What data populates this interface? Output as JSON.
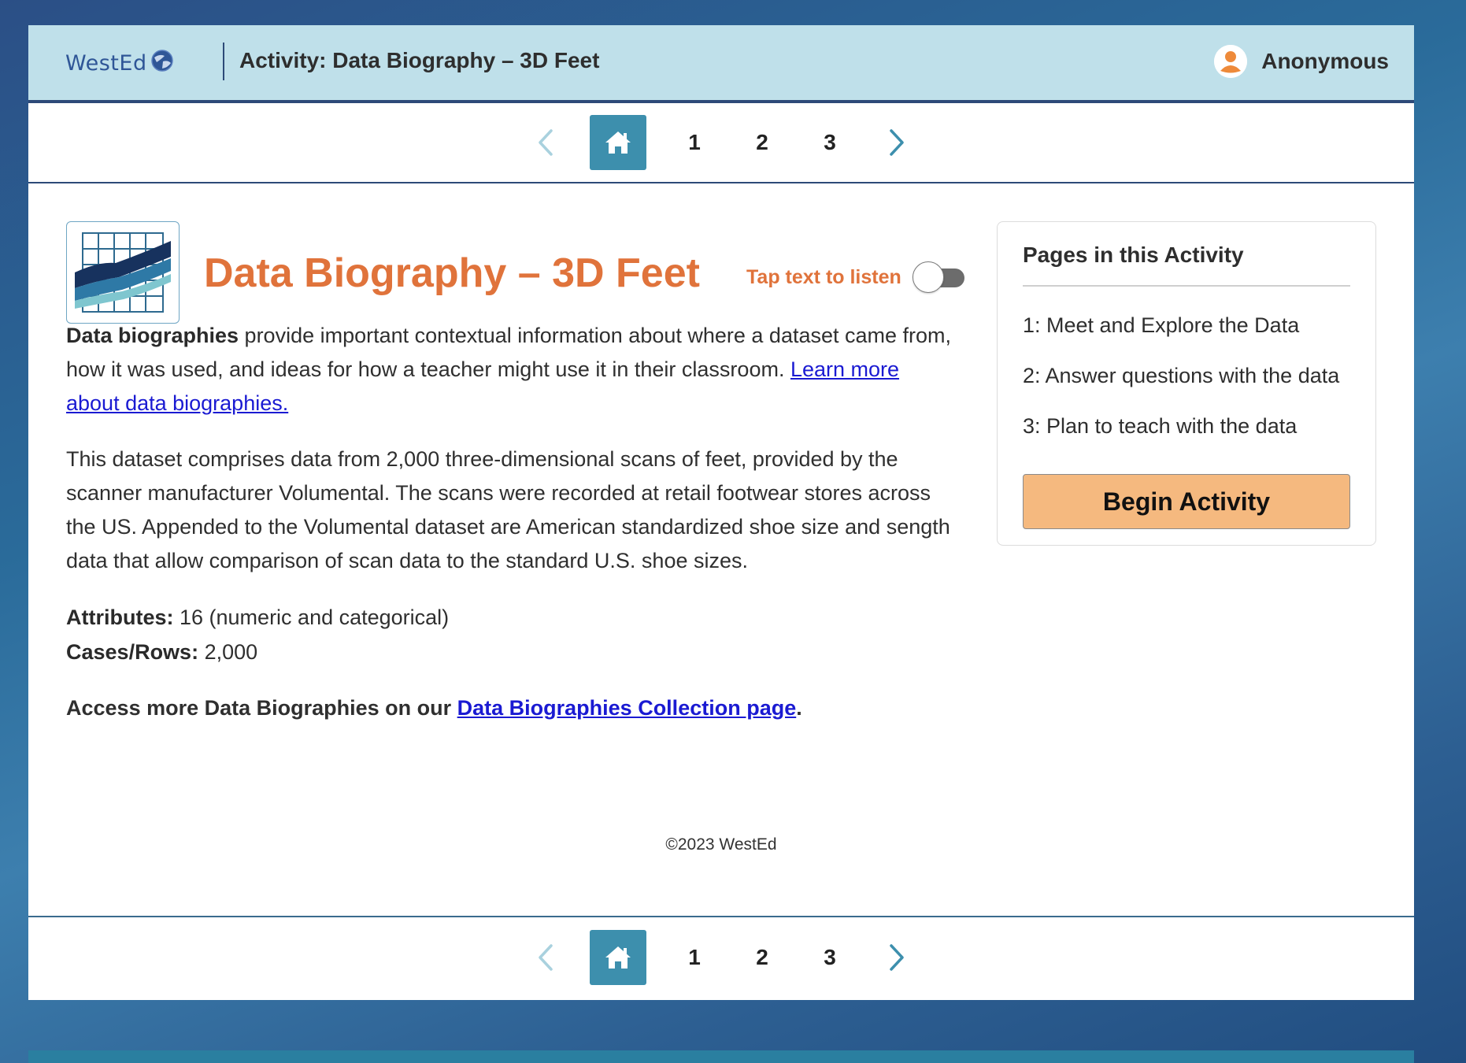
{
  "header": {
    "logo_text": "WestEd",
    "title": "Activity: Data Biography – 3D Feet",
    "user_name": "Anonymous"
  },
  "pager": {
    "pages": [
      "1",
      "2",
      "3"
    ]
  },
  "main": {
    "title": "Data Biography – 3D Feet",
    "listen_label": "Tap text to listen",
    "intro_bold": "Data biographies",
    "intro_text": " provide important contextual information about where a dataset came from, how it was used, and ideas for how a teacher might use it in their classroom. ",
    "intro_link": "Learn more about data biographies.",
    "description": "This dataset comprises data from 2,000 three-dimensional scans of feet, provided by the scanner manufacturer Volumental. The scans were recorded at retail footwear stores across the US. Appended to the Volumental dataset are American standardized shoe size and sength data that allow comparison of scan data to the standard U.S. shoe sizes.",
    "attributes_label": "Attributes:",
    "attributes_value": " 16 (numeric and categorical)",
    "cases_label": "Cases/Rows:",
    "cases_value": " 2,000",
    "access_text": "Access more Data Biographies on our ",
    "access_link": "Data Biographies Collection page",
    "access_end": ".",
    "copyright": "©2023 WestEd"
  },
  "sidebar": {
    "title": "Pages in this Activity",
    "items": [
      "1: Meet and Explore the Data",
      "2: Answer questions with the data",
      "3: Plan to teach with the data"
    ],
    "begin_button": "Begin Activity"
  },
  "colors": {
    "accent_orange": "#e0733b",
    "header_bg": "#bfe0ea",
    "home_button": "#3d8fad",
    "begin_button": "#f5b97f"
  }
}
